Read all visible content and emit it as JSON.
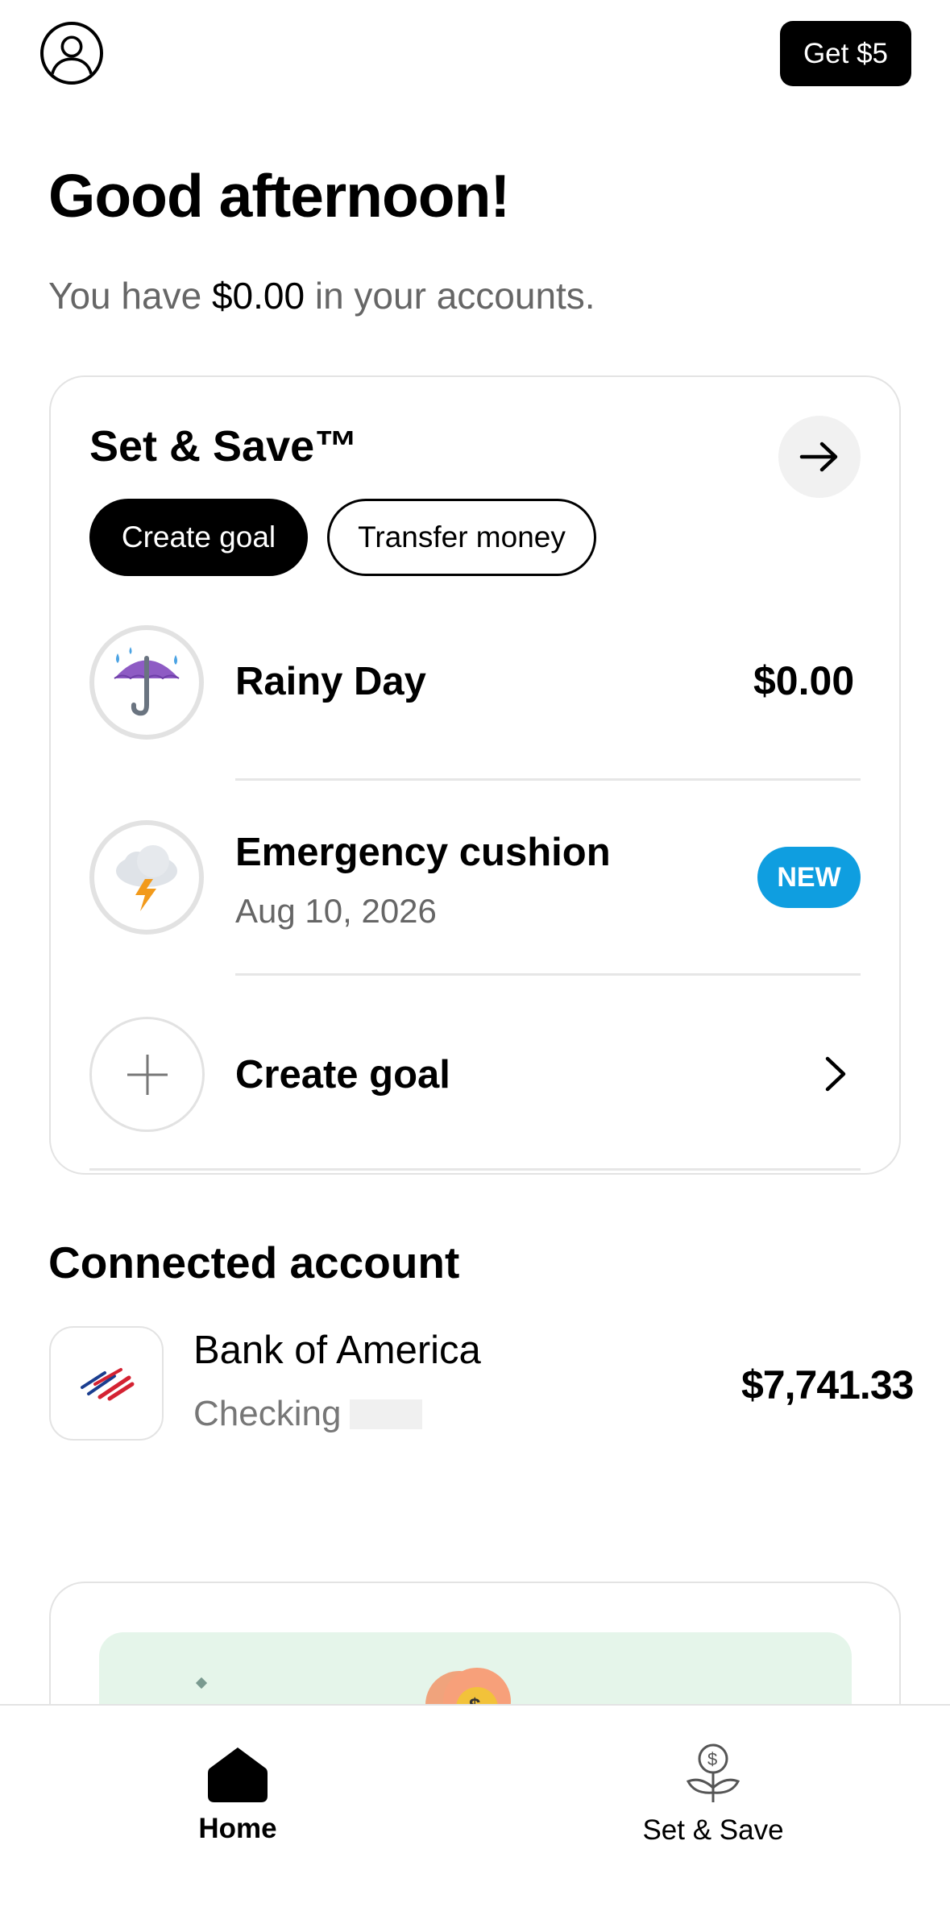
{
  "header": {
    "profile_icon": "user-circle-icon",
    "promo_button": "Get $5"
  },
  "greeting": "Good afternoon!",
  "balance": {
    "prefix": "You have",
    "amount": "$0.00",
    "suffix": "in your accounts."
  },
  "set_and_save": {
    "title": "Set & Save™",
    "arrow_icon": "arrow-right-icon",
    "create_goal_button": "Create goal",
    "transfer_button": "Transfer money",
    "goals": [
      {
        "name": "Rainy Day",
        "amount": "$0.00",
        "icon": "umbrella-rain-icon"
      },
      {
        "name": "Emergency cushion",
        "date": "Aug 10, 2026",
        "badge": "NEW",
        "icon": "storm-cloud-icon"
      }
    ],
    "create_goal_row": "Create goal"
  },
  "connected": {
    "title": "Connected account",
    "bank_name": "Bank of America",
    "account_type": "Checking",
    "amount": "$7,741.33"
  },
  "nav": {
    "home": "Home",
    "set_save": "Set & Save"
  },
  "colors": {
    "accent_blue": "#0f9ee0",
    "promo_green": "#e5f5ea",
    "primary": "#000000"
  }
}
